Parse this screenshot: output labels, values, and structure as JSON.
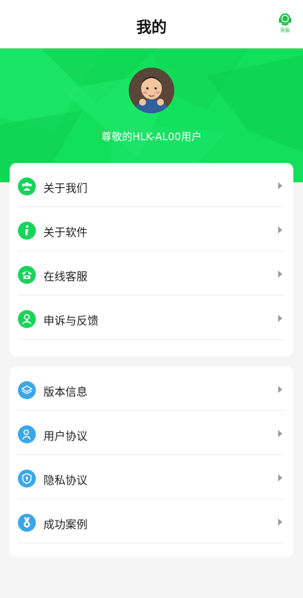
{
  "header": {
    "title": "我的",
    "service_label": "客服"
  },
  "profile": {
    "username": "尊敬的HLK-AL00用户"
  },
  "menu_group_1": [
    {
      "label": "关于我们",
      "icon": "users-icon"
    },
    {
      "label": "关于软件",
      "icon": "info-icon"
    },
    {
      "label": "在线客服",
      "icon": "phone-icon"
    },
    {
      "label": "申诉与反馈",
      "icon": "feedback-icon"
    }
  ],
  "menu_group_2": [
    {
      "label": "版本信息",
      "icon": "layers-icon"
    },
    {
      "label": "用户协议",
      "icon": "user-agreement-icon"
    },
    {
      "label": "隐私协议",
      "icon": "shield-icon"
    },
    {
      "label": "成功案例",
      "icon": "medal-icon"
    }
  ],
  "colors": {
    "accent_green": "#13e05a",
    "icon_green": "#18d45a",
    "icon_blue": "#3aa7e8",
    "background": "#f5f5f5"
  }
}
